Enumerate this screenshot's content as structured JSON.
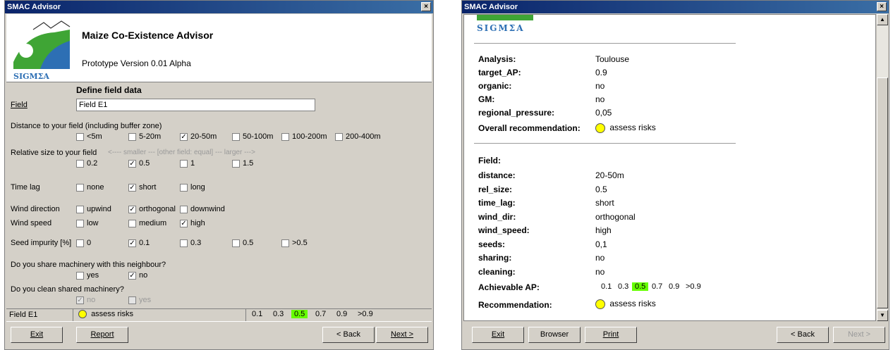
{
  "left": {
    "title": "SMAC Advisor",
    "close": "×",
    "header": {
      "app_name": "Maize Co-Existence Advisor",
      "version": "Prototype Version 0.01 Alpha",
      "logo_text": "SIGMΣA"
    },
    "define_title": "Define field data",
    "field_label": "Field",
    "field_value": "Field E1",
    "distance_label": "Distance to your field (including buffer zone)",
    "distance_options": [
      "<5m",
      "5-20m",
      "20-50m",
      "50-100m",
      "100-200m",
      "200-400m"
    ],
    "distance_checked": [
      false,
      false,
      true,
      false,
      false,
      false
    ],
    "relsize_label": "Relative size to your field",
    "relsize_hint": "<---- smaller ---    [other field: equal]    --- larger --->",
    "relsize_options": [
      "0.2",
      "0.5",
      "1",
      "1.5"
    ],
    "relsize_checked": [
      false,
      true,
      false,
      false
    ],
    "timelag_label": "Time lag",
    "timelag_options": [
      "none",
      "short",
      "long"
    ],
    "timelag_checked": [
      false,
      true,
      false
    ],
    "winddir_label": "Wind direction",
    "winddir_options": [
      "upwind",
      "orthogonal",
      "downwind"
    ],
    "winddir_checked": [
      false,
      true,
      false
    ],
    "windspeed_label": "Wind speed",
    "windspeed_options": [
      "low",
      "medium",
      "high"
    ],
    "windspeed_checked": [
      false,
      false,
      true
    ],
    "seed_label": "Seed impurity [%]",
    "seed_options": [
      "0",
      "0.1",
      "0.3",
      "0.5",
      ">0.5"
    ],
    "seed_checked": [
      false,
      true,
      false,
      false,
      false
    ],
    "share_label": "Do you share machinery with this neighbour?",
    "share_options": [
      "yes",
      "no"
    ],
    "share_checked": [
      false,
      true
    ],
    "clean_label": "Do you clean shared machinery?",
    "clean_options": [
      "no",
      "yes"
    ],
    "clean_checked": [
      true,
      false
    ],
    "status": {
      "field": "Field E1",
      "recommendation": "assess risks",
      "ap_values": [
        "0.1",
        "0.3",
        "0.5",
        "0.7",
        "0.9",
        ">0.9"
      ],
      "ap_selected": "0.5"
    },
    "buttons": {
      "exit": "Exit",
      "report": "Report",
      "back": "< Back",
      "next": "Next >"
    }
  },
  "right": {
    "title": "SMAC Advisor",
    "close": "×",
    "logo_text": "SIGMΣA",
    "analysis": [
      {
        "label": "Analysis:",
        "value": "Toulouse"
      },
      {
        "label": "target_AP:",
        "value": "0.9"
      },
      {
        "label": "organic:",
        "value": "no"
      },
      {
        "label": "GM:",
        "value": "no"
      },
      {
        "label": "regional_pressure:",
        "value": "0,05"
      }
    ],
    "overall_label": "Overall recommendation:",
    "overall_value": "assess risks",
    "field_heading": "Field:",
    "field_rows": [
      {
        "label": "distance:",
        "value": "20-50m"
      },
      {
        "label": "rel_size:",
        "value": "0.5"
      },
      {
        "label": "time_lag:",
        "value": "short"
      },
      {
        "label": "wind_dir:",
        "value": "orthogonal"
      },
      {
        "label": "wind_speed:",
        "value": "high"
      },
      {
        "label": "seeds:",
        "value": "0,1"
      },
      {
        "label": "sharing:",
        "value": "no"
      },
      {
        "label": "cleaning:",
        "value": "no"
      }
    ],
    "ap_label": "Achievable AP:",
    "ap_values": [
      "0.1",
      "0.3",
      "0.5",
      "0.7",
      "0.9",
      ">0.9"
    ],
    "ap_selected": "0.5",
    "rec_label": "Recommendation:",
    "rec_value": "assess risks",
    "buttons": {
      "exit": "Exit",
      "browser": "Browser",
      "print": "Print",
      "back": "< Back",
      "next": "Next >"
    },
    "next_disabled": true,
    "colors": {
      "highlight": "#66ff00",
      "indicator": "#ffff00",
      "titlebar": "#0a246a"
    }
  }
}
